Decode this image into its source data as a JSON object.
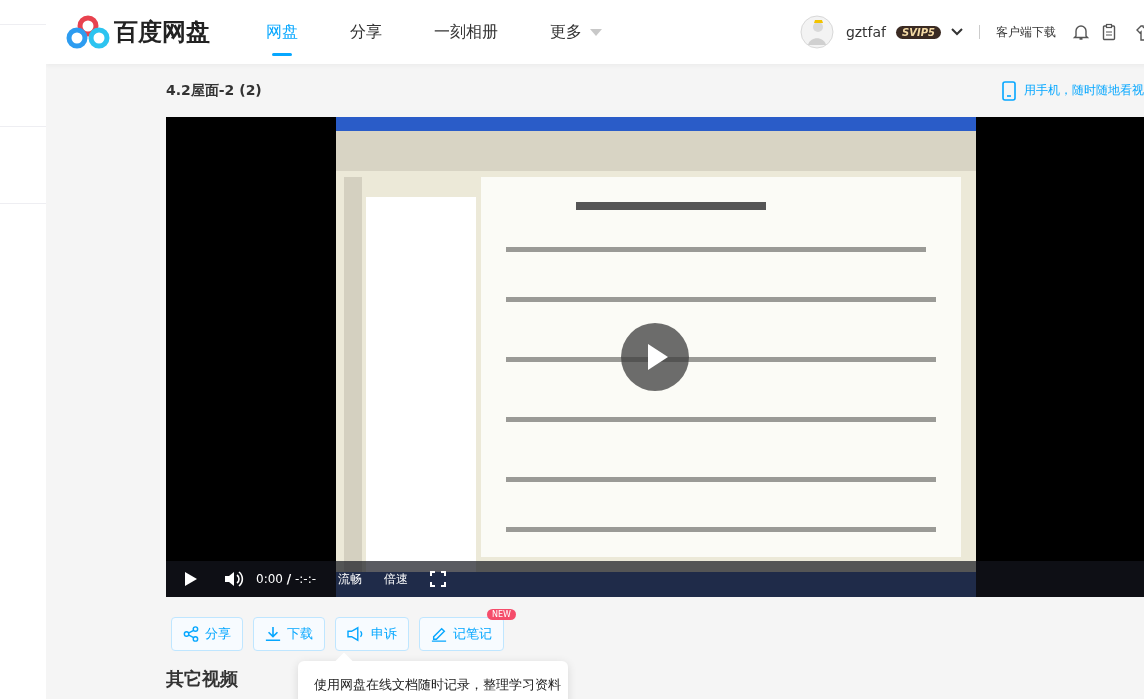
{
  "logo": {
    "text": "百度网盘"
  },
  "nav": [
    {
      "label": "网盘",
      "selected": true
    },
    {
      "label": "分享",
      "selected": false
    },
    {
      "label": "一刻相册",
      "selected": false
    },
    {
      "label": "更多",
      "selected": false,
      "dropdown": true
    }
  ],
  "user": {
    "name": "gztfaf",
    "badge": "SVIP5"
  },
  "client_link": "客户端下载",
  "title": "4.2屋面-2 (2)",
  "mobile_link": "用手机，随时随地看视",
  "player": {
    "time": "0:00",
    "separator": "/",
    "duration": "-:-:-",
    "quality": "流畅",
    "speed": "倍速"
  },
  "actions": [
    {
      "kind": "share",
      "label": "分享"
    },
    {
      "kind": "download",
      "label": "下载"
    },
    {
      "kind": "report",
      "label": "申诉"
    },
    {
      "kind": "note",
      "label": "记笔记",
      "badge": "NEW"
    }
  ],
  "section_title": "其它视频",
  "tooltip": "使用网盘在线文档随时记录，整理学习资料"
}
